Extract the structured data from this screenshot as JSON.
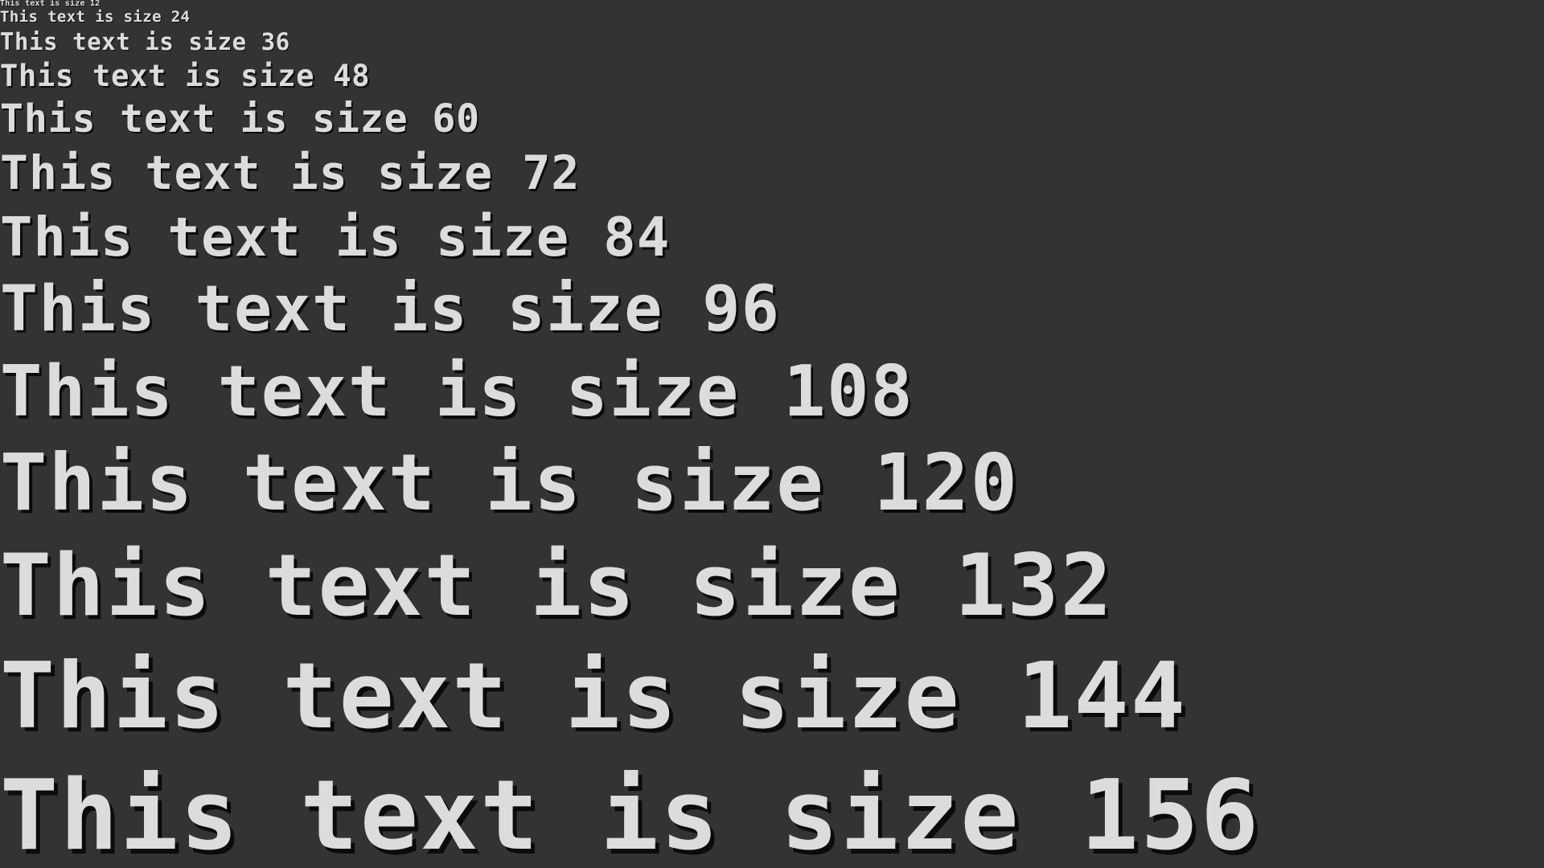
{
  "lines": [
    "This text is size 12",
    "This text is size 24",
    "This text is size 36",
    "This text is size 48",
    "This text is size 60",
    "This text is size 72",
    "This text is size 84",
    "This text is size 96",
    "This text is size 108",
    "This text is size 120",
    "This text is size 132",
    "This text is size 144",
    "This text is size 156"
  ],
  "colors": {
    "background": "#333333",
    "text": "#dcdcdc",
    "shadow": "#0b0b0b"
  }
}
